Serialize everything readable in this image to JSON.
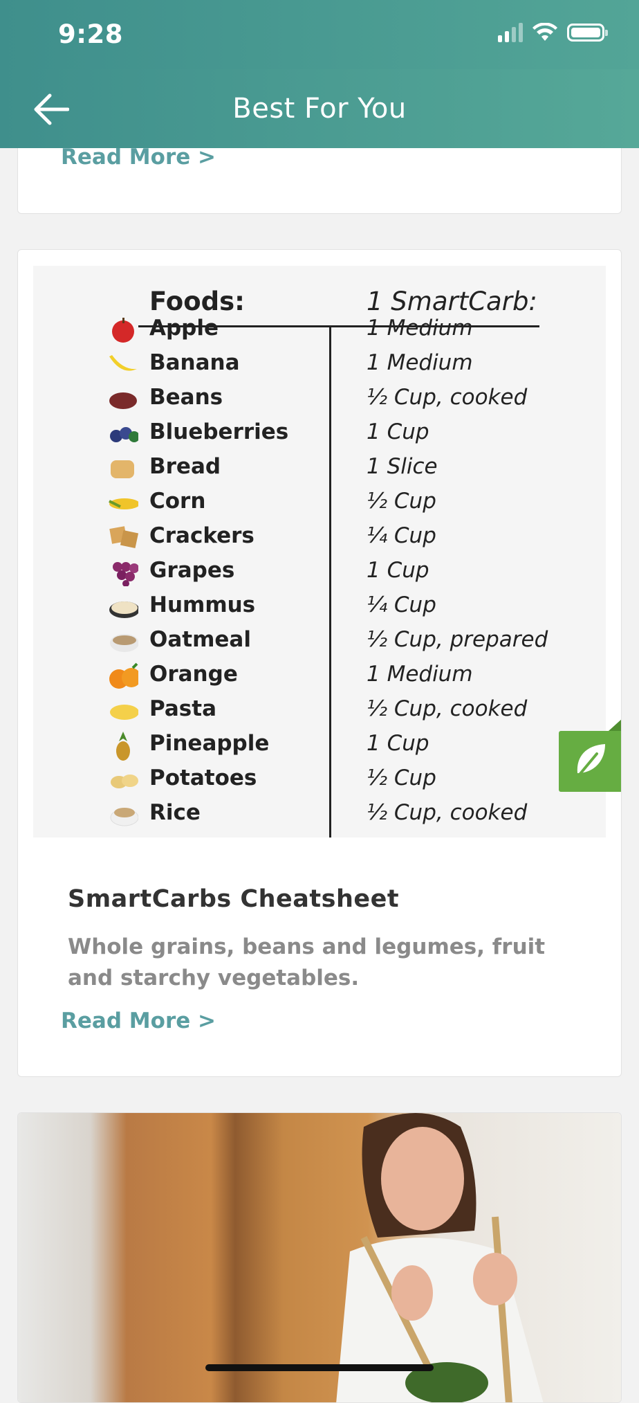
{
  "status_bar": {
    "time": "9:28",
    "icons": [
      "cellular-signal-icon",
      "wifi-icon",
      "battery-icon"
    ]
  },
  "nav": {
    "title": "Best For You",
    "back_icon": "arrow-left-icon"
  },
  "cards": [
    {
      "read_more": "Read More >"
    },
    {
      "cheatsheet": {
        "column_foods": "Foods:",
        "column_amount": "1 SmartCarb:",
        "rows": [
          {
            "food": "Apple",
            "amount": "1 Medium",
            "icon": "apple-icon"
          },
          {
            "food": "Banana",
            "amount": "1 Medium",
            "icon": "banana-icon"
          },
          {
            "food": "Beans",
            "amount": "½ Cup, cooked",
            "icon": "beans-icon"
          },
          {
            "food": "Blueberries",
            "amount": "1 Cup",
            "icon": "blueberries-icon"
          },
          {
            "food": "Bread",
            "amount": "1 Slice",
            "icon": "bread-icon"
          },
          {
            "food": "Corn",
            "amount": "½ Cup",
            "icon": "corn-icon"
          },
          {
            "food": "Crackers",
            "amount": "¼ Cup",
            "icon": "crackers-icon"
          },
          {
            "food": "Grapes",
            "amount": "1 Cup",
            "icon": "grapes-icon"
          },
          {
            "food": "Hummus",
            "amount": "¼ Cup",
            "icon": "hummus-icon"
          },
          {
            "food": "Oatmeal",
            "amount": "½ Cup, prepared",
            "icon": "oatmeal-icon"
          },
          {
            "food": "Orange",
            "amount": "1 Medium",
            "icon": "orange-icon"
          },
          {
            "food": "Pasta",
            "amount": "½ Cup, cooked",
            "icon": "pasta-icon"
          },
          {
            "food": "Pineapple",
            "amount": "1 Cup",
            "icon": "pineapple-icon"
          },
          {
            "food": "Potatoes",
            "amount": "½ Cup",
            "icon": "potatoes-icon"
          },
          {
            "food": "Rice",
            "amount": "½ Cup, cooked",
            "icon": "rice-icon"
          }
        ],
        "badge_icon": "leaf-icon"
      },
      "title": "SmartCarbs Cheatsheet",
      "description": "Whole grains, beans and legumes, fruit and starchy vegetables.",
      "read_more": "Read More >"
    },
    {
      "image": "woman-tossing-salad-photo"
    }
  ],
  "colors": {
    "header": "#4a9a93",
    "accent_link": "#5a9ea1",
    "leaf_badge": "#66ad42"
  }
}
